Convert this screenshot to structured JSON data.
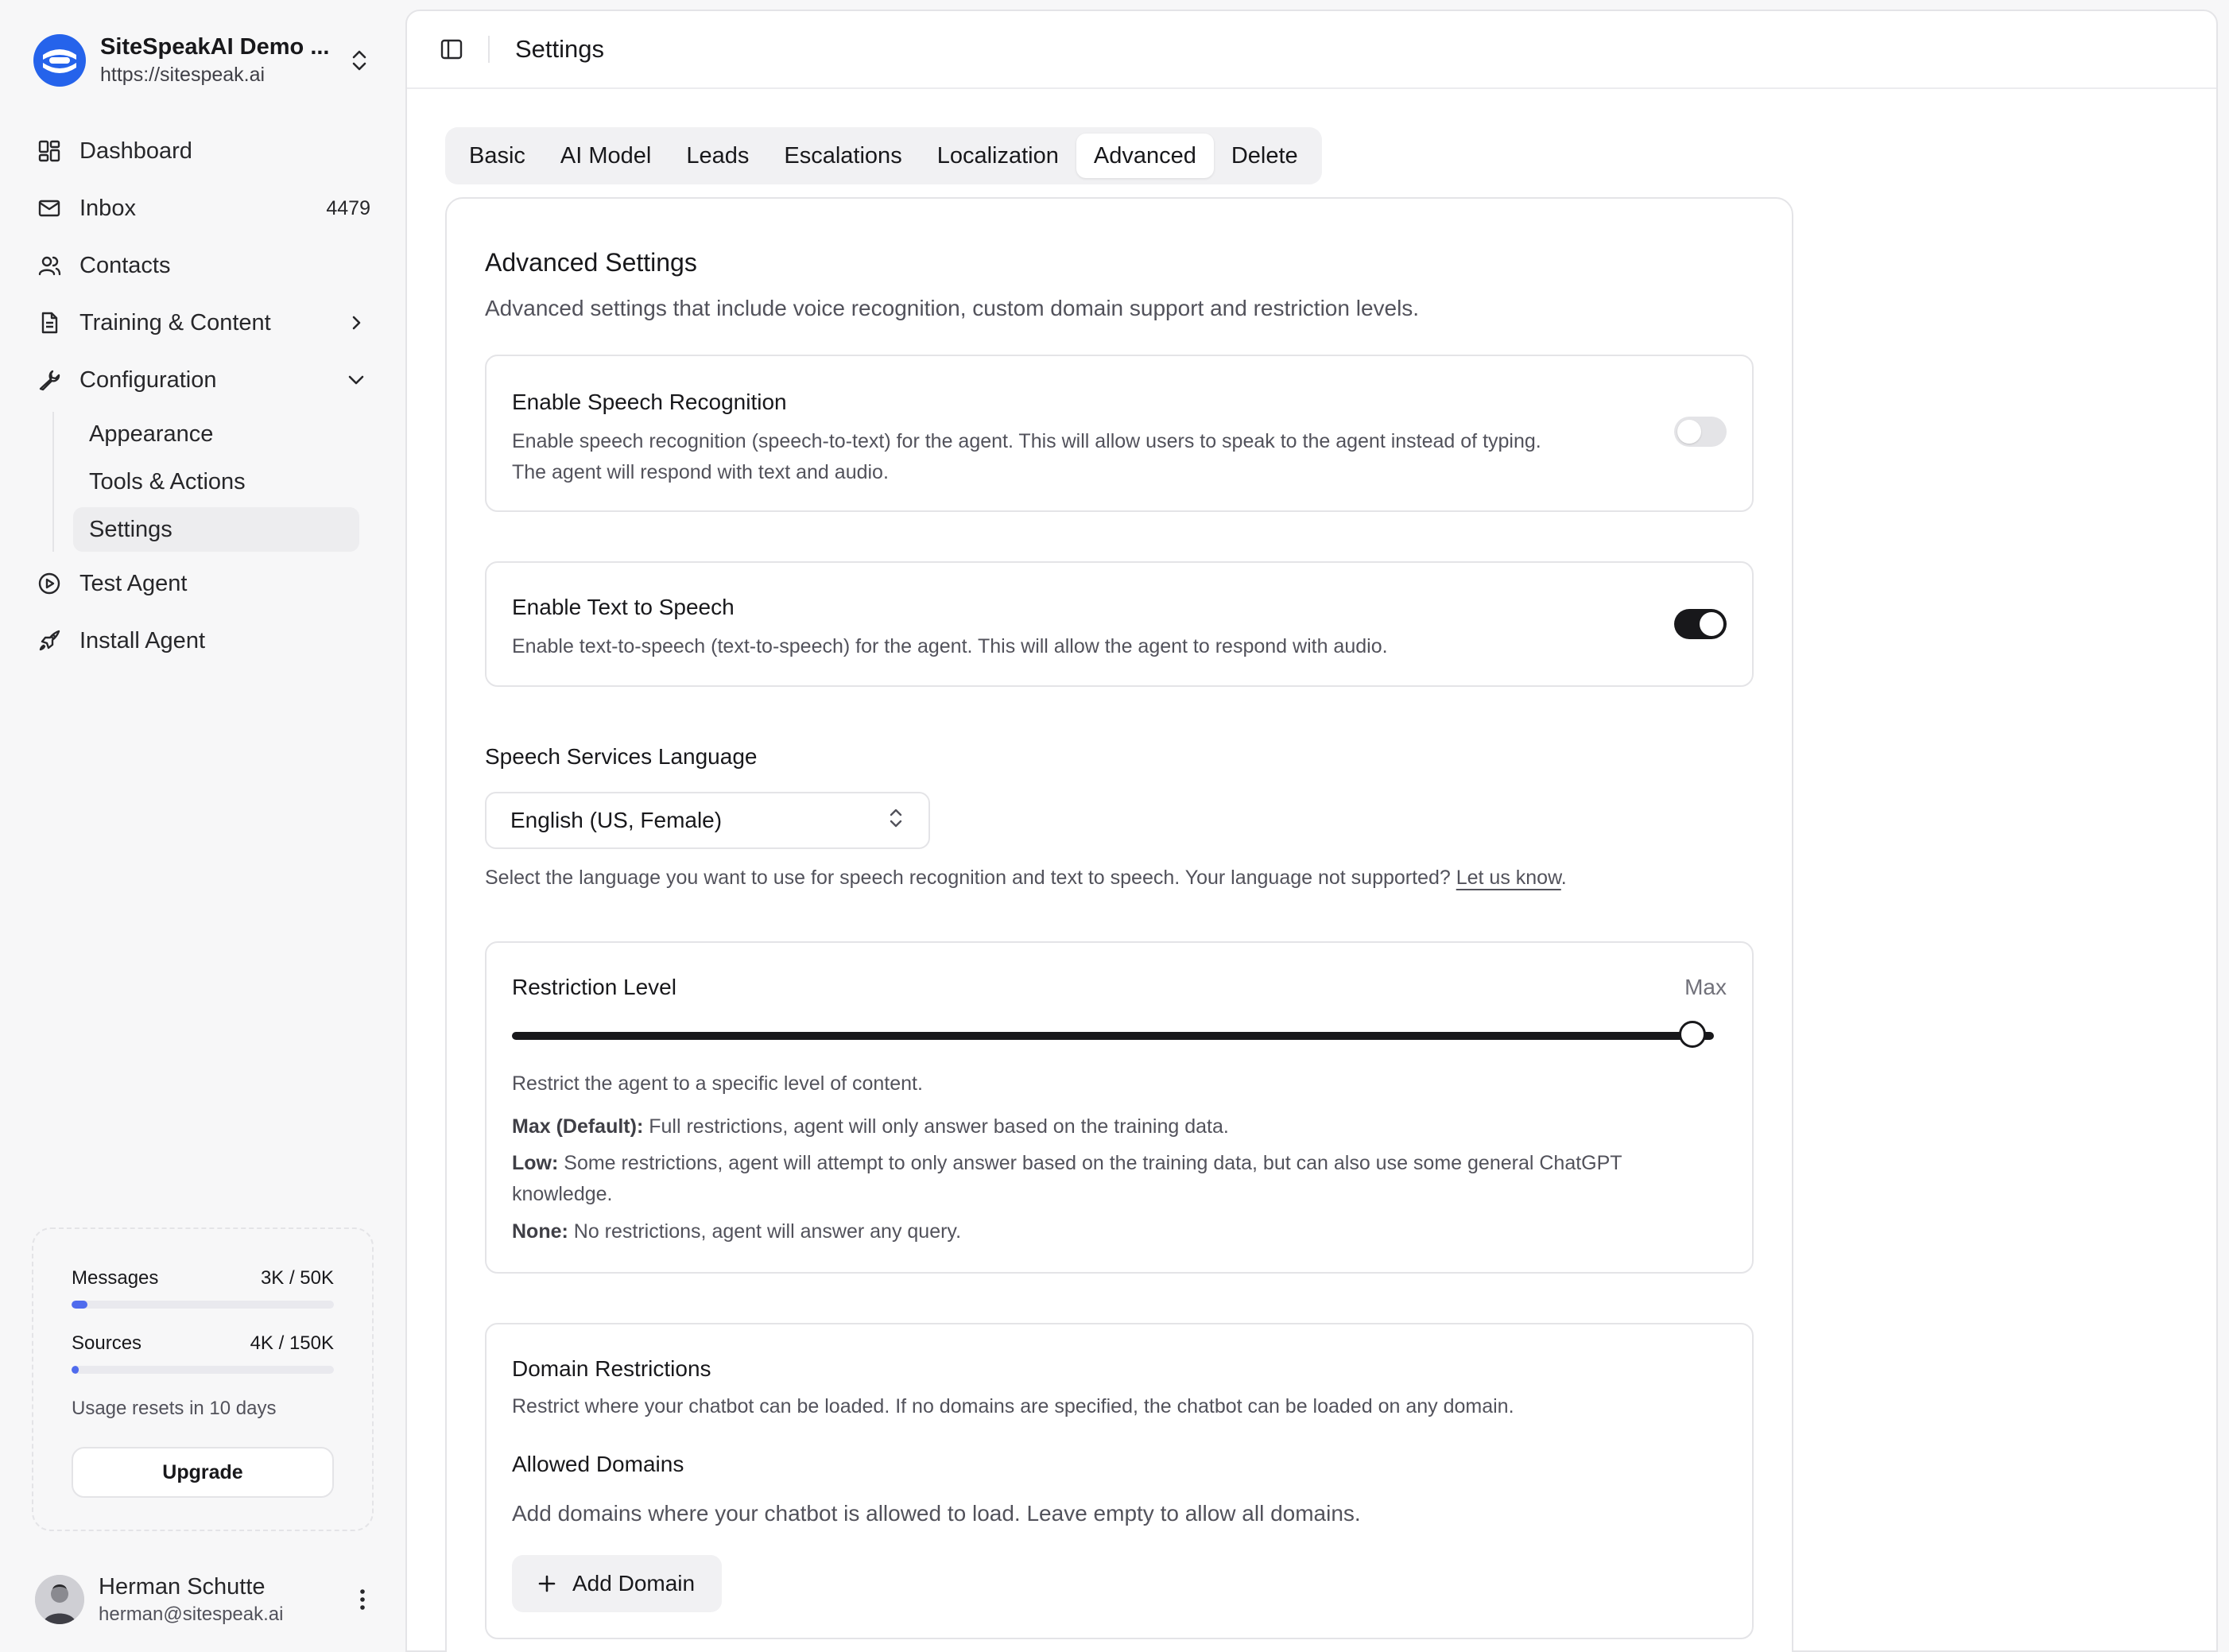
{
  "sidebar": {
    "brand": {
      "name": "SiteSpeakAI Demo ...",
      "url": "https://sitespeak.ai"
    },
    "nav": {
      "dashboard": "Dashboard",
      "inbox": "Inbox",
      "inbox_count": "4479",
      "contacts": "Contacts",
      "training": "Training & Content",
      "configuration": "Configuration",
      "sub": {
        "appearance": "Appearance",
        "tools": "Tools & Actions",
        "settings": "Settings"
      },
      "test_agent": "Test Agent",
      "install_agent": "Install Agent"
    },
    "usage": {
      "messages_label": "Messages",
      "messages_value": "3K / 50K",
      "messages_fraction": 0.06,
      "sources_label": "Sources",
      "sources_value": "4K / 150K",
      "sources_fraction": 0.027,
      "note": "Usage resets in 10 days",
      "upgrade": "Upgrade"
    },
    "user": {
      "name": "Herman Schutte",
      "email": "herman@sitespeak.ai"
    }
  },
  "header": {
    "title": "Settings"
  },
  "tabs": [
    "Basic",
    "AI Model",
    "Leads",
    "Escalations",
    "Localization",
    "Advanced",
    "Delete"
  ],
  "active_tab": "Advanced",
  "advanced": {
    "title": "Advanced Settings",
    "description": "Advanced settings that include voice recognition, custom domain support and restriction levels.",
    "speech_recognition": {
      "title": "Enable Speech Recognition",
      "desc1": "Enable speech recognition (speech-to-text) for the agent. This will allow users to speak to the agent instead of typing.",
      "desc2": "The agent will respond with text and audio.",
      "enabled": false
    },
    "text_to_speech": {
      "title": "Enable Text to Speech",
      "desc": "Enable text-to-speech (text-to-speech) for the agent. This will allow the agent to respond with audio.",
      "enabled": true
    },
    "language": {
      "label": "Speech Services Language",
      "value": "English (US, Female)",
      "help": "Select the language you want to use for speech recognition and text to speech. Your language not supported?",
      "link": "Let us know",
      "help_end": "."
    },
    "restriction": {
      "title": "Restriction Level",
      "value": "Max",
      "desc": "Restrict the agent to a specific level of content.",
      "max_label": "Max (Default):",
      "max_text": "Full restrictions, agent will only answer based on the training data.",
      "low_label": "Low:",
      "low_text": "Some restrictions, agent will attempt to only answer based on the training data, but can also use some general ChatGPT",
      "low_text2": "knowledge.",
      "none_label": "None:",
      "none_text": "No restrictions, agent will answer any query."
    },
    "domains": {
      "title": "Domain Restrictions",
      "desc": "Restrict where your chatbot can be loaded. If no domains are specified, the chatbot can be loaded on any domain.",
      "allowed_title": "Allowed Domains",
      "allowed_desc": "Add domains where your chatbot is allowed to load. Leave empty to allow all domains.",
      "add_button": "Add Domain"
    }
  },
  "colors": {
    "accent": "#4f6bed",
    "brand": "#2563eb",
    "toggle_on": "#18181b"
  }
}
